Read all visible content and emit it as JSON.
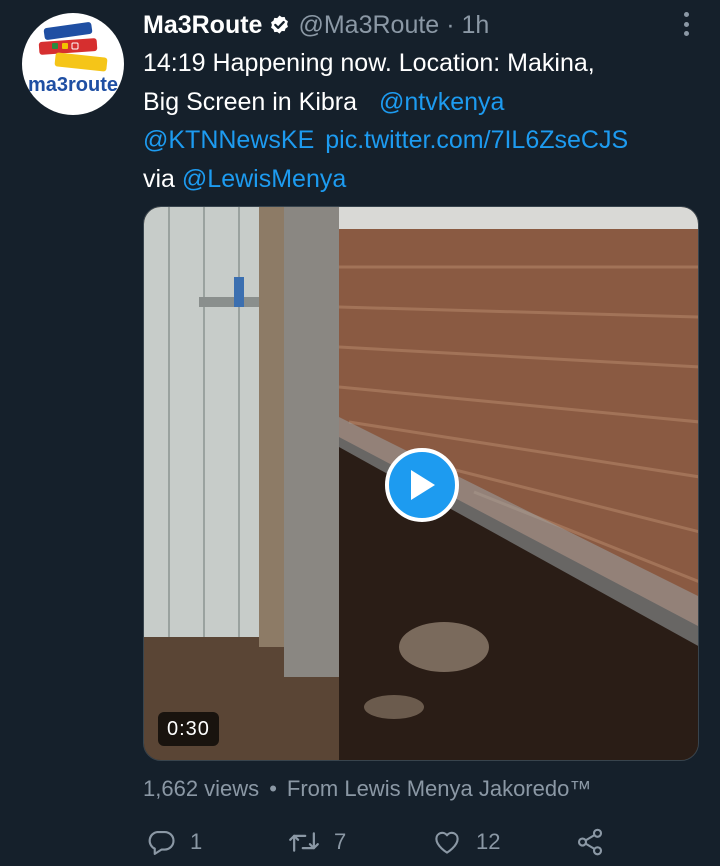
{
  "tweet": {
    "author_name": "Ma3Route",
    "handle": "@Ma3Route",
    "separator": "·",
    "time": "1h",
    "avatar_logo_text": "ma3route",
    "text": {
      "line1": "14:19 Happening now. Location: Makina,",
      "line2_plain": "Big Screen in Kibra",
      "mention_ntv": "@ntvkenya",
      "mention_ktn": "@KTNNewsKE",
      "pic_link": "pic.twitter.com/7IL6ZseCJS",
      "via": "via",
      "mention_lewis": "@LewisMenya"
    },
    "media": {
      "duration": "0:30",
      "play_icon": "play-icon"
    },
    "meta": {
      "views": "1,662 views",
      "separator": "•",
      "source": "From Lewis Menya Jakoredo™"
    },
    "actions": {
      "reply_count": "1",
      "retweet_count": "7",
      "like_count": "12"
    }
  },
  "colors": {
    "background": "#15202b",
    "link": "#1d9bf0",
    "secondary_text": "#8b98a5",
    "verified_badge": "#ffffff"
  }
}
